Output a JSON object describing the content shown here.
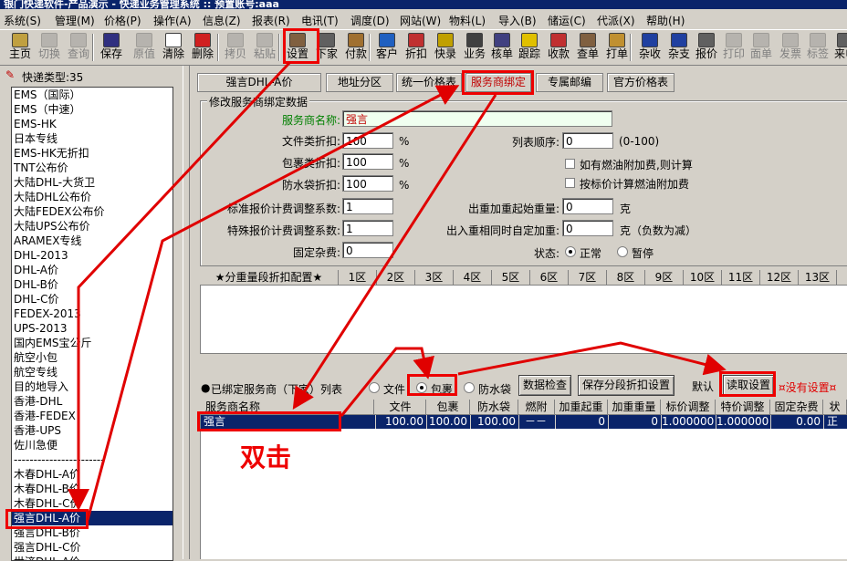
{
  "window": {
    "title": "银门快递软件-产品演示 - 快递业务管理系统  ::  预置账号:aaa"
  },
  "menu": [
    "系统(S)",
    "管理(M)",
    "价格(P)",
    "操作(A)",
    "信息(Z)",
    "报表(R)",
    "电讯(T)",
    "调度(D)",
    "网站(W)",
    "物料(L)",
    "导入(B)",
    "储运(C)",
    "代派(X)",
    "帮助(H)"
  ],
  "toolbar": [
    {
      "label": "主页",
      "icon": "home-icon",
      "enabled": true,
      "color": "#c0a040"
    },
    {
      "label": "切换",
      "icon": "switch-icon",
      "enabled": false,
      "color": "#808080"
    },
    {
      "label": "查询",
      "icon": "binoculars-icon",
      "enabled": false,
      "color": "#808080"
    },
    {
      "label": "保存",
      "icon": "floppy-icon",
      "enabled": true,
      "color": "#303080"
    },
    {
      "label": "原值",
      "icon": "revert-icon",
      "enabled": false,
      "color": "#808080"
    },
    {
      "label": "清除",
      "icon": "clear-icon",
      "enabled": true,
      "color": "#ffffff"
    },
    {
      "label": "删除",
      "icon": "delete-icon",
      "enabled": true,
      "color": "#d02020"
    },
    {
      "label": "拷贝",
      "icon": "copy-icon",
      "enabled": false,
      "color": "#808080"
    },
    {
      "label": "粘贴",
      "icon": "paste-icon",
      "enabled": false,
      "color": "#808080"
    },
    {
      "label": "设置",
      "icon": "settings-icon",
      "enabled": true,
      "color": "#806040"
    },
    {
      "label": "下家",
      "icon": "downline-icon",
      "enabled": true,
      "color": "#606060"
    },
    {
      "label": "付款",
      "icon": "payment-icon",
      "enabled": true,
      "color": "#a07030"
    },
    {
      "label": "客户",
      "icon": "customer-icon",
      "enabled": true,
      "color": "#2060c0"
    },
    {
      "label": "折扣",
      "icon": "discount-icon",
      "enabled": true,
      "color": "#c03030"
    },
    {
      "label": "快录",
      "icon": "quick-entry-icon",
      "enabled": true,
      "color": "#c0a000"
    },
    {
      "label": "业务",
      "icon": "business-icon",
      "enabled": true,
      "color": "#404040"
    },
    {
      "label": "核单",
      "icon": "verify-icon",
      "enabled": true,
      "color": "#404080"
    },
    {
      "label": "跟踪",
      "icon": "track-icon",
      "enabled": true,
      "color": "#e0c000"
    },
    {
      "label": "收款",
      "icon": "receive-icon",
      "enabled": true,
      "color": "#c03030"
    },
    {
      "label": "查单",
      "icon": "query-order-icon",
      "enabled": true,
      "color": "#806040"
    },
    {
      "label": "打单",
      "icon": "print-order-icon",
      "enabled": true,
      "color": "#c09030"
    },
    {
      "label": "杂收",
      "icon": "misc-income-icon",
      "enabled": true,
      "color": "#2040a0"
    },
    {
      "label": "杂支",
      "icon": "misc-expense-icon",
      "enabled": true,
      "color": "#2040a0"
    },
    {
      "label": "报价",
      "icon": "quote-icon",
      "enabled": true,
      "color": "#606060"
    },
    {
      "label": "打印",
      "icon": "print-icon",
      "enabled": false,
      "color": "#808080"
    },
    {
      "label": "面单",
      "icon": "waybill-icon",
      "enabled": false,
      "color": "#808080"
    },
    {
      "label": "发票",
      "icon": "invoice-icon",
      "enabled": false,
      "color": "#808080"
    },
    {
      "label": "标签",
      "icon": "label-icon",
      "enabled": false,
      "color": "#808080"
    },
    {
      "label": "来电",
      "icon": "incoming-call-icon",
      "enabled": true,
      "color": "#606060"
    }
  ],
  "left": {
    "header": "快递类型:35",
    "items": [
      "EMS（国际）",
      "EMS（中速）",
      "EMS-HK",
      "日本专线",
      "EMS-HK无折扣",
      "TNT公布价",
      "大陆DHL-大货卫",
      "大陆DHL公布价",
      "大陆FEDEX公布价",
      "大陆UPS公布价",
      "ARAMEX专线",
      "DHL-2013",
      "DHL-A价",
      "DHL-B价",
      "DHL-C价",
      "FEDEX-2013",
      "UPS-2013",
      "国内EMS宝公斤",
      "航空小包",
      "航空专线",
      "目的地导入",
      "香港-DHL",
      "香港-FEDEX",
      "香港-UPS",
      "佐川急便",
      "-----------------------",
      "木春DHL-A价",
      "木春DHL-B价",
      "木春DHL-C价",
      "强言DHL-A价",
      "强言DHL-B价",
      "强言DHL-C价",
      "世济DHL-A价"
    ],
    "selected_index": 29
  },
  "tabs": [
    "强言DHL-A价",
    "地址分区",
    "统一价格表",
    "服务商绑定",
    "专属邮编",
    "官方价格表"
  ],
  "group": {
    "title": "修改服务商绑定数据",
    "provider_label": "服务商名称:",
    "provider_value": "强言",
    "doc_discount_label": "文件类折扣:",
    "doc_discount_value": "100",
    "pkg_discount_label": "包裹类折扣:",
    "pkg_discount_value": "100",
    "wp_discount_label": "防水袋折扣:",
    "wp_discount_value": "100",
    "percent": "%",
    "std_coef_label": "标准报价计费调整系数:",
    "std_coef_value": "1",
    "spec_coef_label": "特殊报价计费调整系数:",
    "spec_coef_value": "1",
    "fixed_fee_label": "固定杂费:",
    "fixed_fee_value": "0",
    "order_label": "列表顺序:",
    "order_value": "0",
    "order_hint": "(0-100)",
    "fuel_cb_label": "如有燃油附加费,则计算",
    "quote_fuel_cb_label": "按标价计算燃油附加费",
    "outweight_label": "出重加重起始重量:",
    "outweight_value": "0",
    "outweight_unit": "克",
    "inout_label": "出入重相同时自定加重:",
    "inout_value": "0",
    "inout_unit": "克（负数为减）",
    "status_label": "状态:",
    "status_normal": "正常",
    "status_pause": "暂停"
  },
  "segments": [
    "★分重量段折扣配置★",
    "1区",
    "2区",
    "3区",
    "4区",
    "5区",
    "6区",
    "7区",
    "8区",
    "9区",
    "10区",
    "11区",
    "12区",
    "13区"
  ],
  "bottom": {
    "list_title": "已绑定服务商（下家）列表",
    "radio_doc": "文件",
    "radio_pkg": "包裹",
    "radio_wp": "防水袋",
    "btn_check": "数据检查",
    "btn_save_seg": "保存分段折扣设置",
    "btn_default": "默认",
    "btn_read": "读取设置",
    "no_setting": "¤没有设置¤"
  },
  "table": {
    "columns": [
      "服务商名称",
      "文件",
      "包裹",
      "防水袋",
      "燃附",
      "加重起重",
      "加重重量",
      "标价调整",
      "特价调整",
      "固定杂费",
      "状"
    ],
    "rows": [
      [
        "强言",
        "100.00",
        "100.00",
        "100.00",
        "－－",
        "0",
        "0",
        "1.000000",
        "1.000000",
        "0.00",
        "正"
      ]
    ]
  },
  "annotation": {
    "double_click": "双击",
    "color": "#e00000"
  }
}
